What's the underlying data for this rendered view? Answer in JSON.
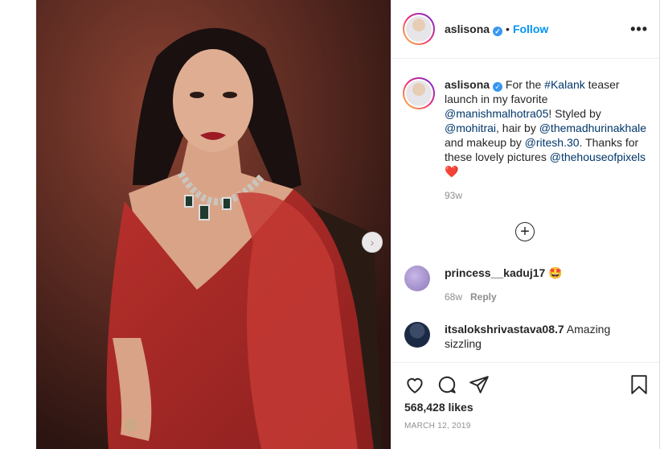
{
  "post": {
    "username": "aslisona",
    "follow_label": "Follow",
    "more_label": "•••",
    "caption_parts": {
      "user": "aslisona",
      "t1": " For the ",
      "m1": "#Kalank",
      "t2": " teaser launch in my favorite ",
      "m2": "@manishmalhotra05",
      "t3": "! Styled by ",
      "m3": "@mohitrai",
      "t4": ", hair by ",
      "m4": "@themadhurinakhale",
      "t5": " and makeup by ",
      "m5": "@ritesh.30",
      "t6": ". Thanks for these lovely pictures ",
      "m6": "@thehouseofpixels",
      "emoji": "❤️"
    },
    "caption_time": "93w",
    "likes": "568,428 likes",
    "date": "MARCH 12, 2019"
  },
  "comments": [
    {
      "user": "princess__kaduj17",
      "text": "🤩",
      "time": "68w",
      "reply": "Reply"
    },
    {
      "user": "itsalokshrivastava08.7",
      "text": "Amazing sizzling"
    }
  ],
  "colors": {
    "accent": "#0095f6",
    "verified": "#3897f0"
  },
  "icons": [
    "heart-icon",
    "comment-icon",
    "share-icon",
    "bookmark-icon",
    "plus-circle-icon",
    "chevron-right-icon"
  ]
}
